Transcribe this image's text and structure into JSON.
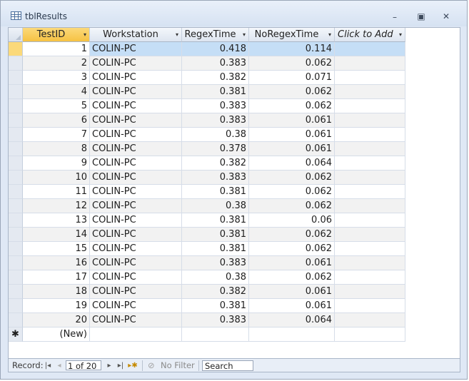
{
  "window": {
    "title": "tblResults",
    "minimize_icon": "minimize-icon",
    "restore_icon": "restore-icon",
    "close_icon": "close-icon"
  },
  "columns": [
    {
      "label": "TestID",
      "arrow": "▾"
    },
    {
      "label": "Workstation",
      "arrow": "▾"
    },
    {
      "label": "RegexTime",
      "arrow": "▾"
    },
    {
      "label": "NoRegexTime",
      "arrow": "▾"
    },
    {
      "label": "Click to Add",
      "arrow": "▾"
    }
  ],
  "rows": [
    {
      "id": "1",
      "ws": "COLIN-PC",
      "rt": "0.418",
      "nrt": "0.114"
    },
    {
      "id": "2",
      "ws": "COLIN-PC",
      "rt": "0.383",
      "nrt": "0.062"
    },
    {
      "id": "3",
      "ws": "COLIN-PC",
      "rt": "0.382",
      "nrt": "0.071"
    },
    {
      "id": "4",
      "ws": "COLIN-PC",
      "rt": "0.381",
      "nrt": "0.062"
    },
    {
      "id": "5",
      "ws": "COLIN-PC",
      "rt": "0.383",
      "nrt": "0.062"
    },
    {
      "id": "6",
      "ws": "COLIN-PC",
      "rt": "0.383",
      "nrt": "0.061"
    },
    {
      "id": "7",
      "ws": "COLIN-PC",
      "rt": "0.38",
      "nrt": "0.061"
    },
    {
      "id": "8",
      "ws": "COLIN-PC",
      "rt": "0.378",
      "nrt": "0.061"
    },
    {
      "id": "9",
      "ws": "COLIN-PC",
      "rt": "0.382",
      "nrt": "0.064"
    },
    {
      "id": "10",
      "ws": "COLIN-PC",
      "rt": "0.383",
      "nrt": "0.062"
    },
    {
      "id": "11",
      "ws": "COLIN-PC",
      "rt": "0.381",
      "nrt": "0.062"
    },
    {
      "id": "12",
      "ws": "COLIN-PC",
      "rt": "0.38",
      "nrt": "0.062"
    },
    {
      "id": "13",
      "ws": "COLIN-PC",
      "rt": "0.381",
      "nrt": "0.06"
    },
    {
      "id": "14",
      "ws": "COLIN-PC",
      "rt": "0.381",
      "nrt": "0.062"
    },
    {
      "id": "15",
      "ws": "COLIN-PC",
      "rt": "0.381",
      "nrt": "0.062"
    },
    {
      "id": "16",
      "ws": "COLIN-PC",
      "rt": "0.383",
      "nrt": "0.061"
    },
    {
      "id": "17",
      "ws": "COLIN-PC",
      "rt": "0.38",
      "nrt": "0.062"
    },
    {
      "id": "18",
      "ws": "COLIN-PC",
      "rt": "0.382",
      "nrt": "0.061"
    },
    {
      "id": "19",
      "ws": "COLIN-PC",
      "rt": "0.381",
      "nrt": "0.061"
    },
    {
      "id": "20",
      "ws": "COLIN-PC",
      "rt": "0.383",
      "nrt": "0.064"
    }
  ],
  "new_row": {
    "marker": "✱",
    "label": "(New)"
  },
  "status": {
    "record_label": "Record:",
    "record_value": "1 of 20",
    "first_icon": "|◂",
    "prev_icon": "◂",
    "next_icon": "▸",
    "last_icon": "▸|",
    "new_icon": "▸✱",
    "filter_icon": "⊘",
    "filter_label": "No Filter",
    "search_value": "Search"
  },
  "colors": {
    "header_active": "#f6c243",
    "row_active": "#c5def6",
    "row_alt": "#f2f2f2"
  }
}
